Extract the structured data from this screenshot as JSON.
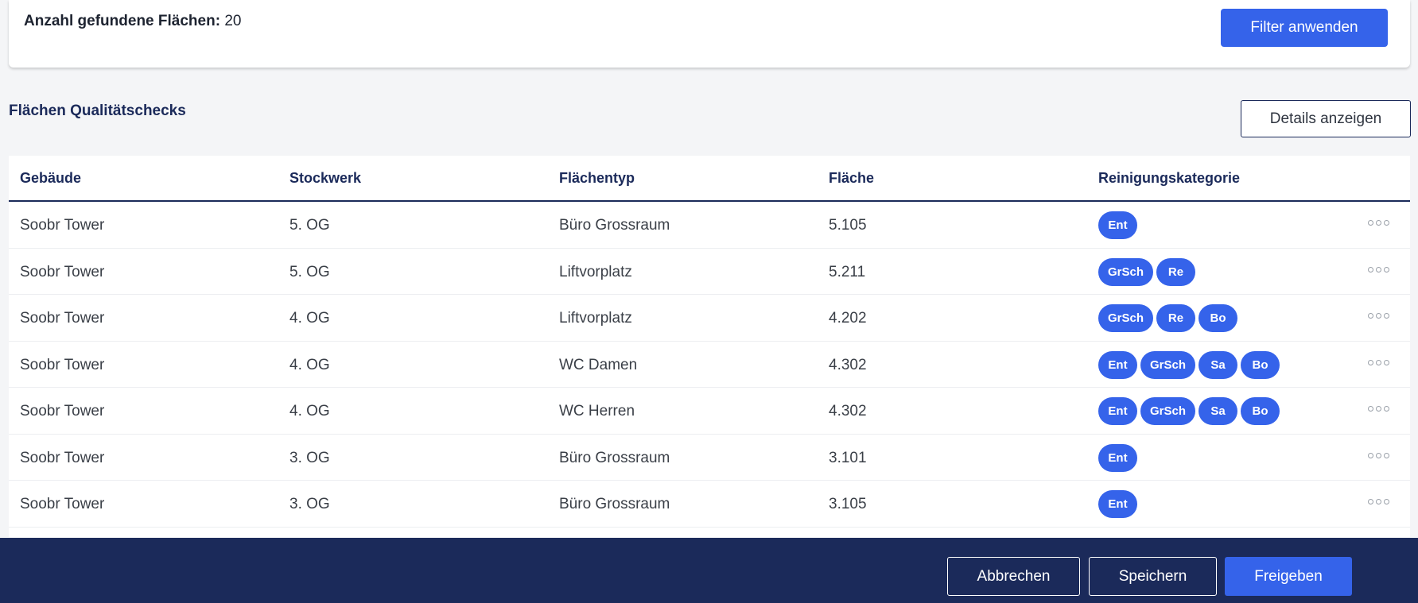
{
  "filter": {
    "count_label": "Anzahl gefundene Flächen:",
    "count_value": "20",
    "apply_button": "Filter anwenden"
  },
  "section": {
    "title": "Flächen Qualitätschecks",
    "details_button": "Details anzeigen"
  },
  "table": {
    "columns": [
      "Gebäude",
      "Stockwerk",
      "Flächentyp",
      "Fläche",
      "Reinigungskategorie"
    ],
    "rows": [
      {
        "building": "Soobr Tower",
        "floor": "5. OG",
        "type": "Büro Grossraum",
        "area": "5.105",
        "tags": [
          "Ent"
        ]
      },
      {
        "building": "Soobr Tower",
        "floor": "5. OG",
        "type": "Liftvorplatz",
        "area": "5.211",
        "tags": [
          "GrSch",
          "Re"
        ]
      },
      {
        "building": "Soobr Tower",
        "floor": "4. OG",
        "type": "Liftvorplatz",
        "area": "4.202",
        "tags": [
          "GrSch",
          "Re",
          "Bo"
        ]
      },
      {
        "building": "Soobr Tower",
        "floor": "4. OG",
        "type": "WC Damen",
        "area": "4.302",
        "tags": [
          "Ent",
          "GrSch",
          "Sa",
          "Bo"
        ]
      },
      {
        "building": "Soobr Tower",
        "floor": "4. OG",
        "type": "WC Herren",
        "area": "4.302",
        "tags": [
          "Ent",
          "GrSch",
          "Sa",
          "Bo"
        ]
      },
      {
        "building": "Soobr Tower",
        "floor": "3. OG",
        "type": "Büro Grossraum",
        "area": "3.101",
        "tags": [
          "Ent"
        ]
      },
      {
        "building": "Soobr Tower",
        "floor": "3. OG",
        "type": "Büro Grossraum",
        "area": "3.105",
        "tags": [
          "Ent"
        ]
      }
    ]
  },
  "footer": {
    "cancel_button": "Abbrechen",
    "save_button": "Speichern",
    "release_button": "Freigeben"
  },
  "colors": {
    "primary": "#3563ea",
    "navy": "#1b2a5a",
    "background": "#f4f5f7"
  }
}
